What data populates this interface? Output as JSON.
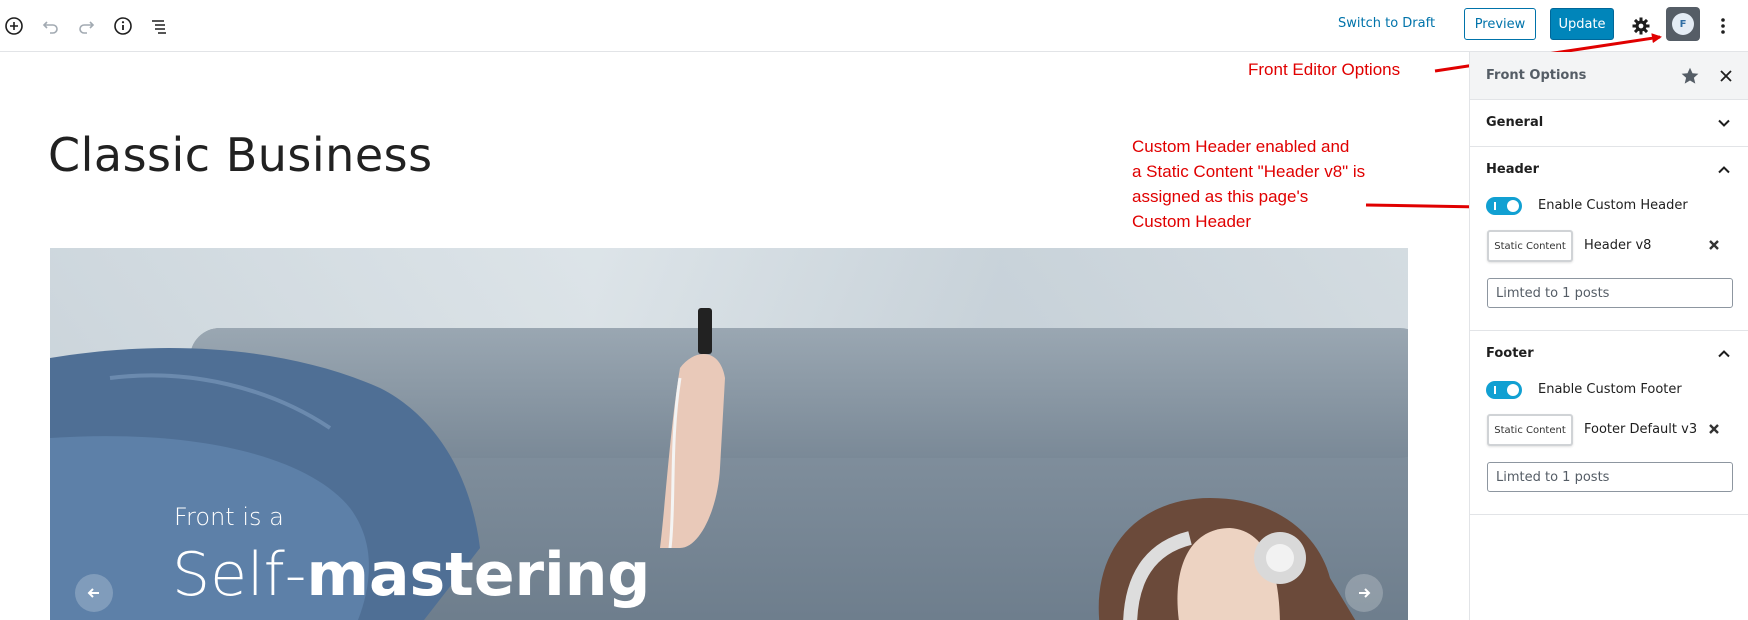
{
  "toolbar": {
    "switch_to_draft": "Switch to Draft",
    "preview": "Preview",
    "update": "Update",
    "front_logo_letter": "F",
    "icons": [
      "add-block-icon",
      "undo-icon",
      "redo-icon",
      "info-icon",
      "outline-icon",
      "gear-icon",
      "more-vertical-icon"
    ]
  },
  "editor": {
    "page_title": "Classic Business",
    "hero": {
      "subtitle": "Front is a",
      "title_light": "Self-",
      "title_bold": "mastering"
    }
  },
  "annotations": {
    "front_editor_options": "Front Editor Options",
    "custom_header_lines": [
      "Custom Header enabled and",
      "a Static Content \"Header v8\" is",
      "assigned as this page's",
      "Custom Header"
    ]
  },
  "sidebar": {
    "title": "Front Options",
    "general": {
      "title": "General"
    },
    "header": {
      "title": "Header",
      "toggle_label": "Enable Custom Header",
      "toggle_on": true,
      "badge": "Static Content",
      "selected": "Header v8",
      "limit_placeholder": "Limted to 1 posts"
    },
    "footer": {
      "title": "Footer",
      "toggle_label": "Enable Custom Footer",
      "toggle_on": true,
      "badge": "Static Content",
      "selected": "Footer Default v3",
      "limit_placeholder": "Limted to 1 posts"
    }
  },
  "colors": {
    "accent": "#0073aa",
    "update_button": "#0085ba",
    "toggle_on": "#11a0d2",
    "annotation": "#e00000"
  }
}
